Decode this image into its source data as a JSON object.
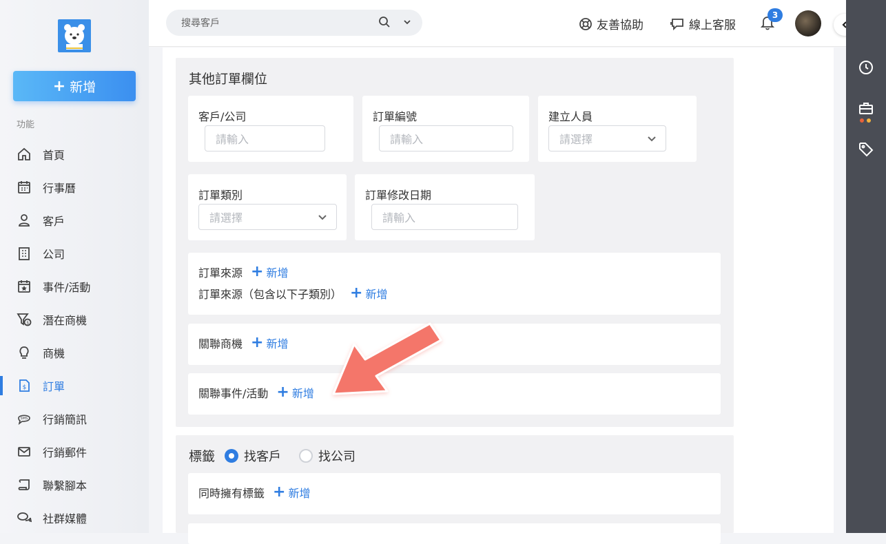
{
  "sidebar": {
    "add_label": "新增",
    "section_label": "功能",
    "items": [
      {
        "label": "首頁",
        "icon": "home-icon"
      },
      {
        "label": "行事曆",
        "icon": "calendar-icon"
      },
      {
        "label": "客戶",
        "icon": "customer-icon"
      },
      {
        "label": "公司",
        "icon": "building-icon"
      },
      {
        "label": "事件/活動",
        "icon": "event-icon"
      },
      {
        "label": "潛在商機",
        "icon": "funnel-icon"
      },
      {
        "label": "商機",
        "icon": "lightbulb-icon"
      },
      {
        "label": "訂單",
        "icon": "order-icon",
        "active": true
      },
      {
        "label": "行銷簡訊",
        "icon": "sms-icon"
      },
      {
        "label": "行銷郵件",
        "icon": "mail-icon"
      },
      {
        "label": "聯繫腳本",
        "icon": "script-icon"
      },
      {
        "label": "社群媒體",
        "icon": "chat-icon"
      }
    ]
  },
  "topbar": {
    "search_placeholder": "搜尋客戶",
    "help_label": "友善協助",
    "support_label": "線上客服",
    "notification_count": "3"
  },
  "other_fields": {
    "title": "其他訂單欄位",
    "customer_label": "客戶/公司",
    "customer_placeholder": "請輸入",
    "order_no_label": "訂單編號",
    "order_no_placeholder": "請輸入",
    "creator_label": "建立人員",
    "creator_placeholder": "請選擇",
    "type_label": "訂單類別",
    "type_placeholder": "請選擇",
    "modified_label": "訂單修改日期",
    "modified_placeholder": "請輸入",
    "source_label": "訂單來源",
    "source_sub_label": "訂單來源（包含以下子類別）",
    "related_opportunity_label": "關聯商機",
    "related_event_label": "關聯事件/活動",
    "add_label": "新增"
  },
  "tags": {
    "title": "標籤",
    "option_customer": "找客戶",
    "option_company": "找公司",
    "selected": "找客戶",
    "has_tags_label": "同時擁有標籤",
    "add_label": "新增"
  },
  "colors": {
    "accent": "#2f7de1",
    "arrow": "#f4766a"
  }
}
